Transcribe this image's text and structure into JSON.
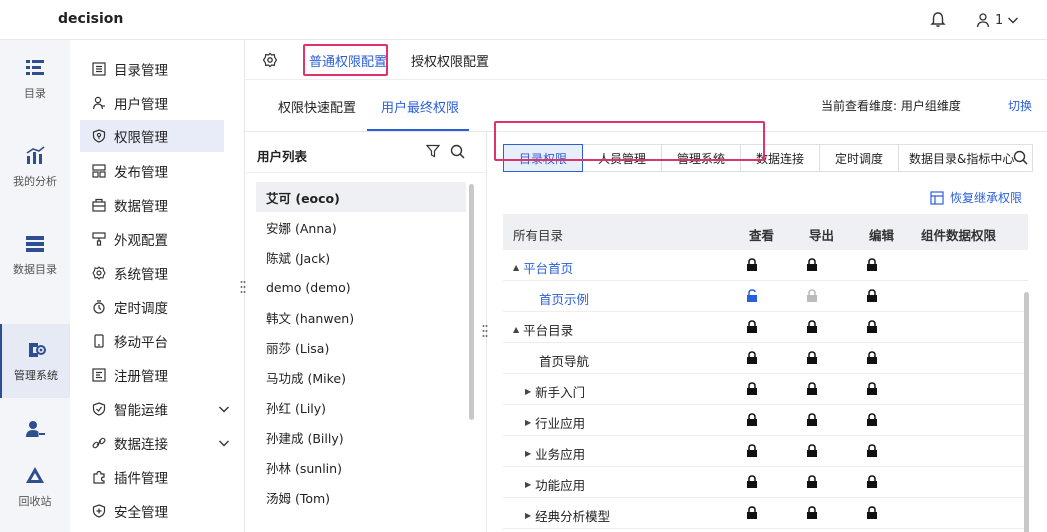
{
  "app": {
    "brand": "decision",
    "user_name": "1"
  },
  "rail": [
    {
      "label": "目录",
      "icon": "catalog-icon"
    },
    {
      "label": "我的分析",
      "icon": "analysis-icon"
    },
    {
      "label": "数据目录",
      "icon": "data-catalog-icon"
    },
    {
      "label": "管理系统",
      "icon": "management-icon",
      "active": true
    },
    {
      "label": "",
      "icon": "user-group-icon"
    },
    {
      "label": "回收站",
      "icon": "recycle-icon"
    }
  ],
  "menu": [
    {
      "label": "目录管理",
      "icon": "list-icon"
    },
    {
      "label": "用户管理",
      "icon": "user-icon"
    },
    {
      "label": "权限管理",
      "icon": "shield-icon",
      "active": true
    },
    {
      "label": "发布管理",
      "icon": "publish-icon"
    },
    {
      "label": "数据管理",
      "icon": "database-icon"
    },
    {
      "label": "外观配置",
      "icon": "brush-icon"
    },
    {
      "label": "系统管理",
      "icon": "gear-icon"
    },
    {
      "label": "定时调度",
      "icon": "timer-icon"
    },
    {
      "label": "移动平台",
      "icon": "mobile-icon"
    },
    {
      "label": "注册管理",
      "icon": "register-icon"
    },
    {
      "label": "智能运维",
      "icon": "ops-icon",
      "expandable": true
    },
    {
      "label": "数据连接",
      "icon": "link-icon",
      "expandable": true
    },
    {
      "label": "插件管理",
      "icon": "plugin-icon"
    },
    {
      "label": "安全管理",
      "icon": "security-icon"
    }
  ],
  "top_tabs": {
    "general": "普通权限配置",
    "grant": "授权权限配置"
  },
  "sub_tabs": {
    "quick": "权限快速配置",
    "final": "用户最终权限"
  },
  "dimension": {
    "label": "当前查看维度: 用户组维度",
    "switch": "切换"
  },
  "user_list": {
    "title": "用户列表",
    "users": [
      "艾可 (eoco)",
      "安娜 (Anna)",
      "陈斌 (Jack)",
      "demo (demo)",
      "韩文 (hanwen)",
      "丽莎 (Lisa)",
      "马功成 (Mike)",
      "孙红 (Lily)",
      "孙建成 (Billy)",
      "孙林 (sunlin)",
      "汤姆 (Tom)"
    ]
  },
  "perm_tabs": [
    "目录权限",
    "人员管理",
    "管理系统",
    "数据连接",
    "定时调度",
    "数据目录&指标中心"
  ],
  "restore_label": "恢复继承权限",
  "table": {
    "headers": {
      "root": "所有目录",
      "view": "查看",
      "export": "导出",
      "edit": "编辑",
      "component": "组件数据权限"
    },
    "rows": [
      {
        "name": "平台首页",
        "indent": 1,
        "expander": "▲",
        "blue": true,
        "view": "locked",
        "export": "locked",
        "edit": "locked"
      },
      {
        "name": "首页示例",
        "indent": 2,
        "expander": "",
        "blue": true,
        "view": "unlocked",
        "export": "disabled",
        "edit": "locked"
      },
      {
        "name": "平台目录",
        "indent": 1,
        "expander": "▲",
        "blue": false,
        "view": "locked",
        "export": "locked",
        "edit": "locked"
      },
      {
        "name": "首页导航",
        "indent": 2,
        "expander": "",
        "blue": false,
        "view": "locked",
        "export": "locked",
        "edit": "locked"
      },
      {
        "name": "新手入门",
        "indent": 2,
        "expander": "▶",
        "blue": false,
        "view": "locked",
        "export": "locked",
        "edit": "locked"
      },
      {
        "name": "行业应用",
        "indent": 2,
        "expander": "▶",
        "blue": false,
        "view": "locked",
        "export": "locked",
        "edit": "locked"
      },
      {
        "name": "业务应用",
        "indent": 2,
        "expander": "▶",
        "blue": false,
        "view": "locked",
        "export": "locked",
        "edit": "locked"
      },
      {
        "name": "功能应用",
        "indent": 2,
        "expander": "▶",
        "blue": false,
        "view": "locked",
        "export": "locked",
        "edit": "locked"
      },
      {
        "name": "经典分析模型",
        "indent": 2,
        "expander": "▶",
        "blue": false,
        "view": "locked",
        "export": "locked",
        "edit": "locked"
      }
    ]
  },
  "colors": {
    "accent": "#2b5fd9",
    "highlight": "#e0326c",
    "lock": "#111111",
    "unlocked": "#2b5fd9",
    "disabled": "#bbbbbb"
  }
}
